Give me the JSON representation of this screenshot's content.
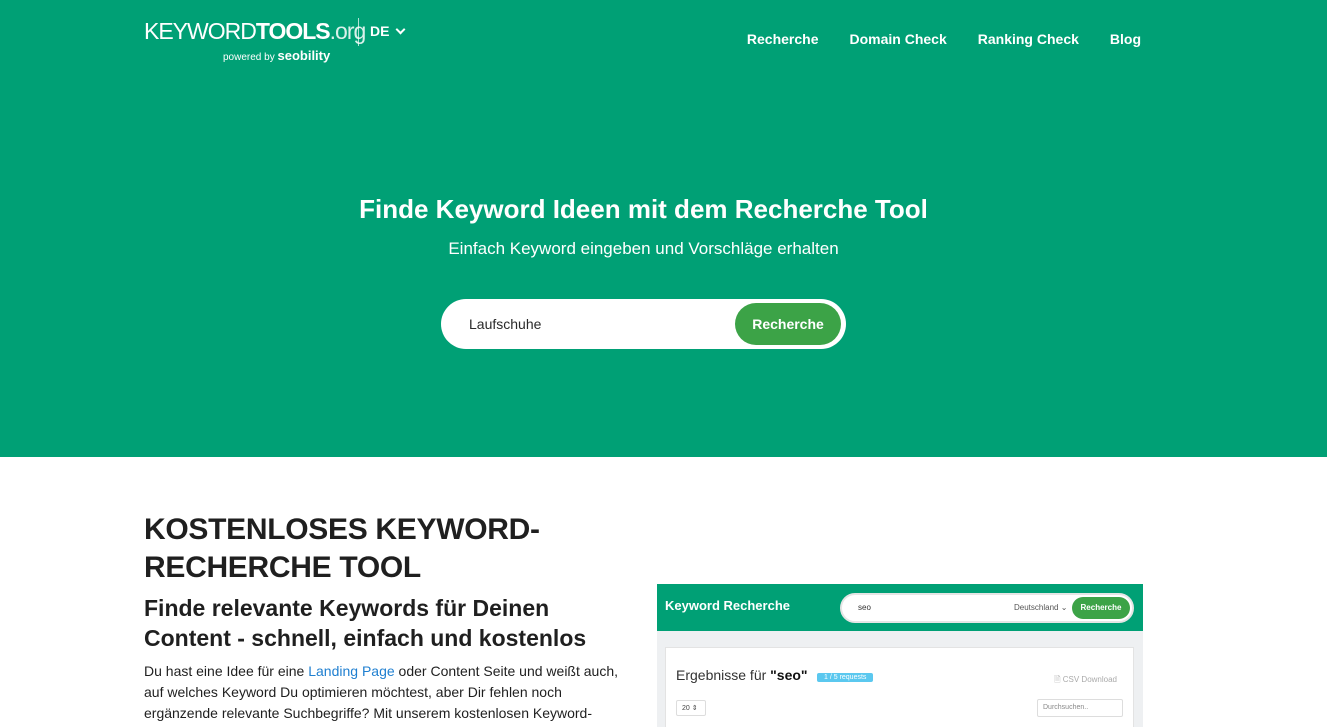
{
  "header": {
    "logo": {
      "main_light": "KEYWORD",
      "main_bold": "TOOLS",
      "main_tld": ".org",
      "powered_by": "powered by",
      "brand": "seobility"
    },
    "language": "DE",
    "nav": [
      {
        "label": "Recherche"
      },
      {
        "label": "Domain Check"
      },
      {
        "label": "Ranking Check"
      },
      {
        "label": "Blog"
      }
    ]
  },
  "hero": {
    "title": "Finde Keyword Ideen mit dem Recherche Tool",
    "subtitle": "Einfach Keyword eingeben und Vorschläge erhalten",
    "search_value": "Laufschuhe",
    "search_button": "Recherche"
  },
  "content": {
    "title": "KOSTENLOSES KEYWORD-RECHERCHE TOOL",
    "subtitle": "Finde relevante Keywords für Deinen Content - schnell, einfach und kostenlos",
    "text_before_link": "Du hast eine Idee für eine ",
    "link_text": "Landing Page",
    "text_after_link": " oder Content Seite und weißt auch, auf welches Keyword Du optimieren möchtest, aber Dir fehlen noch ergänzende relevante Suchbegriffe? Mit unserem kostenlosen Keyword-"
  },
  "preview": {
    "title": "Keyword Recherche",
    "search_value": "seo",
    "country": "Deutschland",
    "button": "Recherche",
    "results_label": "Ergebnisse für",
    "results_query": "\"seo\"",
    "badge": "1 / 5 requests",
    "csv": "CSV Download",
    "per_page": "20",
    "filter_placeholder": "Durchsuchen.."
  },
  "colors": {
    "brand_green": "#00a075",
    "button_green": "#3ca347",
    "link_blue": "#1f7fd0"
  }
}
